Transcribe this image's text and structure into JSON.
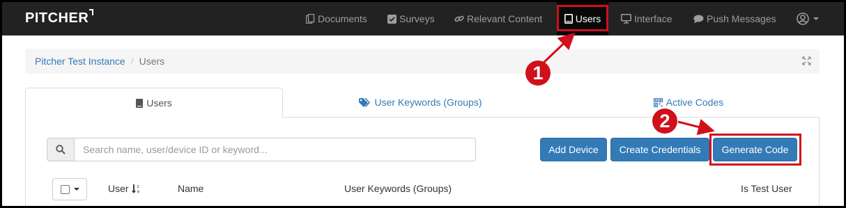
{
  "navbar": {
    "brand": "PITCHER",
    "items": [
      {
        "label": "Documents",
        "icon": "documents-icon"
      },
      {
        "label": "Surveys",
        "icon": "check-square-icon"
      },
      {
        "label": "Relevant Content",
        "icon": "link-icon"
      },
      {
        "label": "Users",
        "icon": "tablet-icon",
        "active": true
      },
      {
        "label": "Interface",
        "icon": "monitor-icon"
      },
      {
        "label": "Push Messages",
        "icon": "comment-icon"
      }
    ],
    "user_menu_icon": "user-circle-icon"
  },
  "breadcrumb": {
    "items": [
      "Pitcher Test Instance",
      "Users"
    ]
  },
  "tabs": [
    {
      "label": "Users",
      "icon": "tablet-icon",
      "active": true
    },
    {
      "label": "User Keywords (Groups)",
      "icon": "tags-icon"
    },
    {
      "label": "Active Codes",
      "icon": "qrcode-icon"
    }
  ],
  "search": {
    "placeholder": "Search name, user/device ID or keyword...",
    "value": ""
  },
  "buttons": {
    "add_device": "Add Device",
    "create_credentials": "Create Credentials",
    "generate_code": "Generate Code"
  },
  "table": {
    "columns": [
      "User",
      "Name",
      "User Keywords (Groups)",
      "Is Test User"
    ],
    "sort_column": "User"
  },
  "annotations": {
    "step1": "1",
    "step2": "2",
    "color": "#d0101b"
  },
  "colors": {
    "navbar_bg": "#222222",
    "primary": "#337ab7",
    "link": "#337ab7"
  }
}
